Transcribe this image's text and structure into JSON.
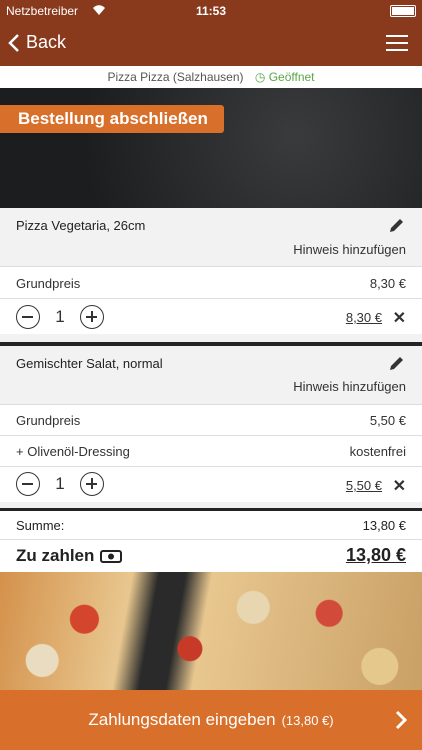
{
  "status": {
    "carrier": "Netzbetreiber",
    "time": "11:53"
  },
  "nav": {
    "back_label": "Back"
  },
  "restaurant": {
    "name": "Pizza Pizza (Salzhausen)",
    "status": "Geöffnet"
  },
  "hero": {
    "cta": "Bestellung abschließen"
  },
  "items": [
    {
      "name": "Pizza Vegetaria, 26cm",
      "hint": "Hinweis hinzufügen",
      "base_label": "Grundpreis",
      "base_price": "8,30 €",
      "qty": "1",
      "total": "8,30 €"
    },
    {
      "name": "Gemischter Salat, normal",
      "hint": "Hinweis hinzufügen",
      "base_label": "Grundpreis",
      "base_price": "5,50 €",
      "extra_label": "+ Olivenöl-Dressing",
      "extra_price": "kostenfrei",
      "qty": "1",
      "total": "5,50 €"
    }
  ],
  "summary": {
    "label": "Summe:",
    "value": "13,80 €",
    "pay_label": "Zu zahlen",
    "pay_value": "13,80 €"
  },
  "footer": {
    "label": "Zahlungsdaten eingeben",
    "amount": "(13,80 €)"
  },
  "colors": {
    "brand": "#8a3a1c",
    "accent": "#d86f2a",
    "open": "#5aa646"
  }
}
